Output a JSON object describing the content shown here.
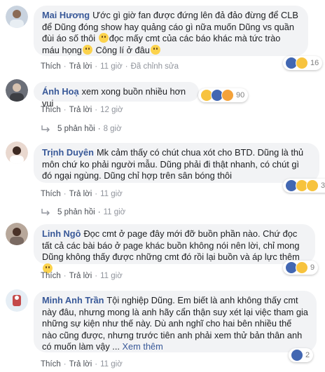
{
  "comments": [
    {
      "author": "Mai Hương",
      "text": "Ước gì giờ fan được đứng lên đả đảo đừng để CLB để Dũng đóng show hay quảng cáo gì nữa muốn Dũng vs quần đùi áo số thôi",
      "text2": "đọc mấy cmt của các báo khác mà tức trào máu họng",
      "text3": "Công lí ở đâu",
      "like": "Thích",
      "reply": "Trả lời",
      "time": "11 giờ",
      "edited": "Đã chỉnh sửa",
      "reaction_count": "16"
    },
    {
      "author": "Ánh Hoạ",
      "text": "xem xong buồn nhiều hơn vui",
      "like": "Thích",
      "reply": "Trả lời",
      "time": "12 giờ",
      "reaction_count": "90",
      "replies_label": "5 phản hồi",
      "replies_time": "8 giờ"
    },
    {
      "author": "Trịnh Duyên",
      "text": "Mk cảm thấy có chút chua xót cho BTD. Dũng là thủ môn chứ ko phải người mẫu. Dũng phải đi thật nhanh, có chút gì đó ngại ngùng. Dũng chỉ hợp trên sân bóng thôi",
      "like": "Thích",
      "reply": "Trả lời",
      "time": "11 giờ",
      "reaction_count": "30",
      "replies_label": "5 phản hồi",
      "replies_time": "11 giờ"
    },
    {
      "author": "Linh Ngô",
      "text": "Đọc cmt ở page đây mới đỡ buồn phần nào. Chứ đọc tất cả các bài báo ở page khác buồn không nói nên lời, chỉ mong Dũng không thấy được những cmt đó rồi lại buồn và áp lực thêm",
      "like": "Thích",
      "reply": "Trả lời",
      "time": "11 giờ",
      "reaction_count": "9"
    },
    {
      "author": "Minh Anh Trần",
      "text": "Tội nghiệp Dũng. Em biết là anh không thấy cmt này đâu, nhưng mong là anh hãy cẩn thận suy xét lại việc tham gia những sự kiện như thế này. Dù anh nghĩ cho hai bên nhiều thế nào cũng được, nhưng trước tiên anh phải xem thử bản thân anh có muốn làm vậy ...",
      "see_more": "Xem thêm",
      "like": "Thích",
      "reply": "Trả lời",
      "time": "11 giờ",
      "reaction_count": "2"
    }
  ],
  "colors": {
    "author": "#385898",
    "bubble": "#f2f3f5",
    "meta": "#90949c",
    "like_blue": "#4267b2"
  }
}
